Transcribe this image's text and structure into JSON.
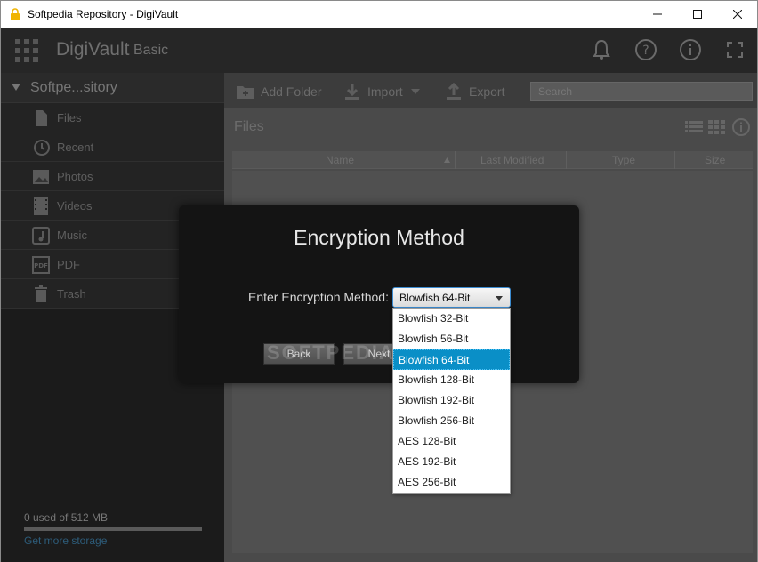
{
  "window": {
    "title": "Softpedia Repository - DigiVault",
    "controls": [
      "minimize",
      "maximize",
      "close"
    ]
  },
  "app": {
    "brand": "DigiVault",
    "edition": "Basic",
    "top_icons": [
      "bell-icon",
      "help-icon",
      "info-icon",
      "fullscreen-icon"
    ]
  },
  "sidebar": {
    "repository": "Softpe...sitory",
    "items": [
      {
        "label": "Files",
        "icon": "file-icon"
      },
      {
        "label": "Recent",
        "icon": "history-icon"
      },
      {
        "label": "Photos",
        "icon": "photo-icon"
      },
      {
        "label": "Videos",
        "icon": "film-icon"
      },
      {
        "label": "Music",
        "icon": "music-icon"
      },
      {
        "label": "PDF",
        "icon": "pdf-icon"
      },
      {
        "label": "Trash",
        "icon": "trash-icon"
      }
    ],
    "storage_text": "0 used of 512 MB",
    "storage_fraction": 0.0,
    "more_storage": "Get more storage"
  },
  "toolbar": {
    "add_folder": "Add Folder",
    "import": "Import",
    "export": "Export",
    "search_placeholder": "Search"
  },
  "files": {
    "title": "Files",
    "columns": [
      "Name",
      "Last Modified",
      "Type",
      "Size"
    ]
  },
  "dialog": {
    "title": "Encryption Method",
    "label": "Enter Encryption Method:",
    "selected": "Blowfish 64-Bit",
    "back": "Back",
    "next": "Next",
    "watermark": "SOFTPEDIA",
    "options": [
      "Blowfish 32-Bit",
      "Blowfish 56-Bit",
      "Blowfish 64-Bit",
      "Blowfish 128-Bit",
      "Blowfish 192-Bit",
      "Blowfish 256-Bit",
      "AES 128-Bit",
      "AES 192-Bit",
      "AES 256-Bit"
    ],
    "selected_index": 2
  },
  "colors": {
    "accent": "#0a8fc7",
    "select_border": "#3b8bd0"
  }
}
